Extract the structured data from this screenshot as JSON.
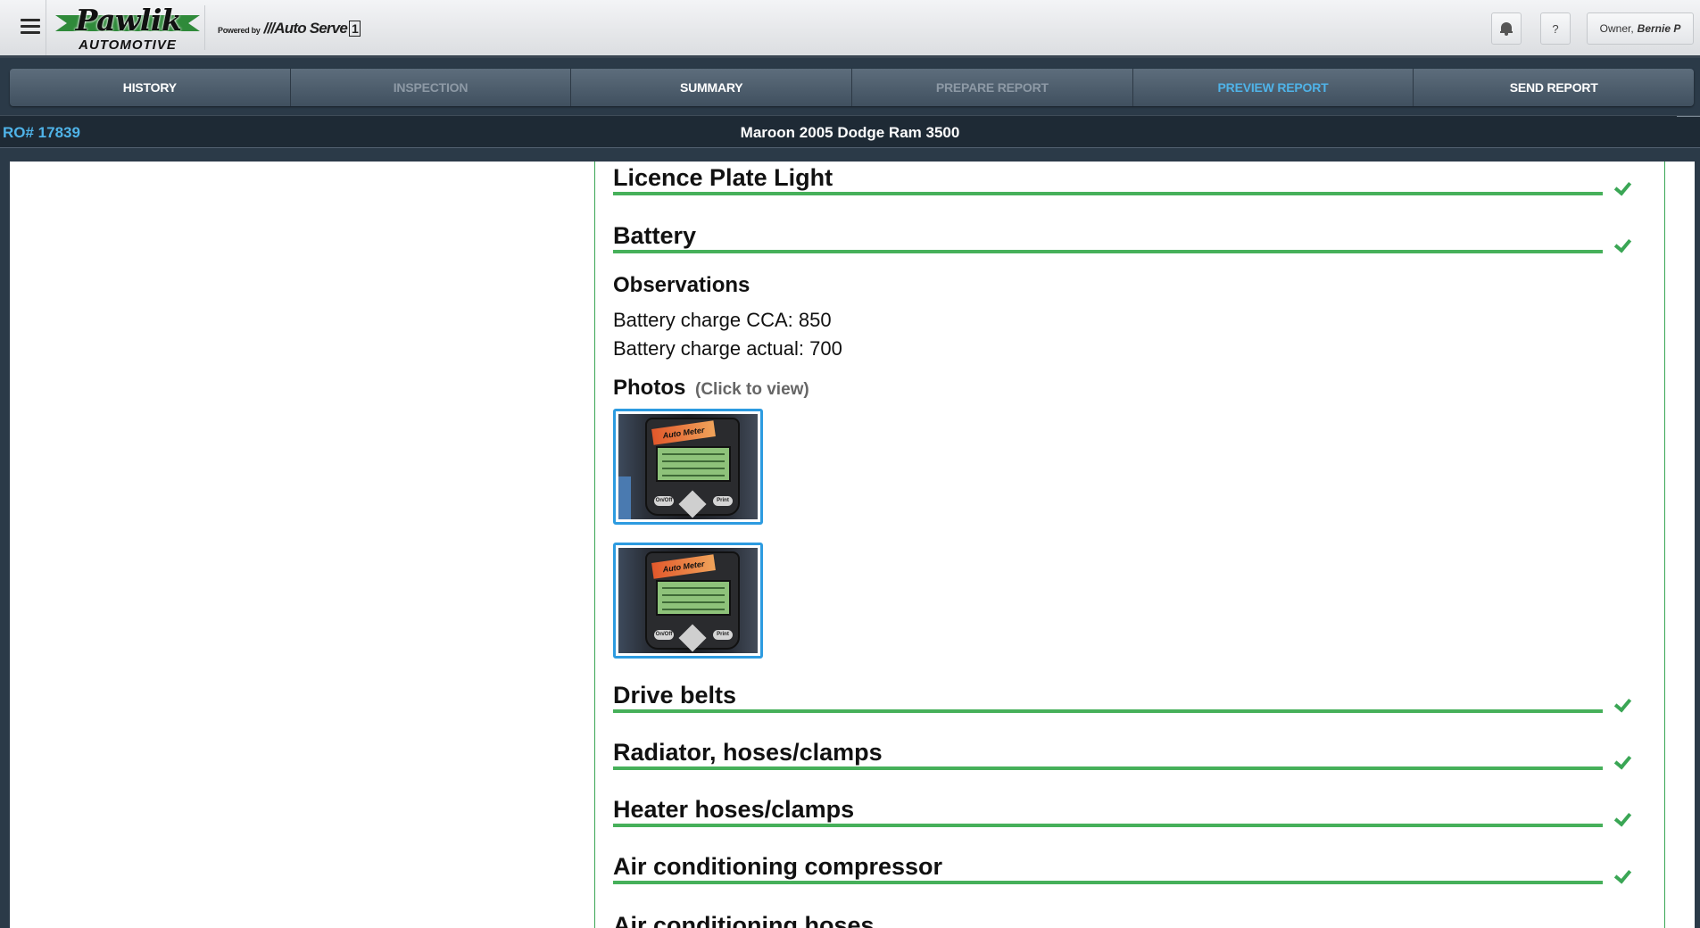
{
  "header": {
    "menu_icon": "hamburger-menu-icon",
    "logo": {
      "name": "Pawlik",
      "sub": "AUTOMOTIVE"
    },
    "powered_by": {
      "label": "Powered by",
      "brand": "Auto Serve",
      "brand_mark": "1"
    },
    "help_label": "?",
    "bell_icon": "bell-icon",
    "owner": {
      "role": "Owner,",
      "name": "Bernie P"
    }
  },
  "tabs": [
    {
      "label": "HISTORY",
      "state": "enabled"
    },
    {
      "label": "INSPECTION",
      "state": "disabled"
    },
    {
      "label": "SUMMARY",
      "state": "enabled"
    },
    {
      "label": "PREPARE REPORT",
      "state": "disabled"
    },
    {
      "label": "PREVIEW REPORT",
      "state": "active"
    },
    {
      "label": "SEND REPORT",
      "state": "enabled"
    }
  ],
  "ro": {
    "number": "RO# 17839",
    "vehicle": "Maroon 2005 Dodge Ram 3500"
  },
  "report": {
    "sections": [
      {
        "title": "Licence Plate Light",
        "status": "ok"
      },
      {
        "title": "Battery",
        "status": "ok"
      },
      {
        "title": "Drive belts",
        "status": "ok"
      },
      {
        "title": "Radiator, hoses/clamps",
        "status": "ok"
      },
      {
        "title": "Heater hoses/clamps",
        "status": "ok"
      },
      {
        "title": "Air conditioning compressor",
        "status": "ok"
      },
      {
        "title": "Air conditioning hoses",
        "status": "ok"
      }
    ],
    "battery_details": {
      "observations_title": "Observations",
      "observations": [
        "Battery charge CCA: 850",
        "Battery charge actual: 700"
      ],
      "photos_title": "Photos",
      "photos_hint": "(Click to view)",
      "photos": [
        {
          "subject": "Auto Meter battery tester",
          "buttons": [
            "On/Off",
            "Print"
          ]
        },
        {
          "subject": "Auto Meter battery tester",
          "buttons": [
            "On/Off",
            "Print"
          ]
        }
      ]
    }
  },
  "colors": {
    "accent_blue": "#4fb3e8",
    "status_green": "#3aa655",
    "navbar": "#2b3a48"
  }
}
